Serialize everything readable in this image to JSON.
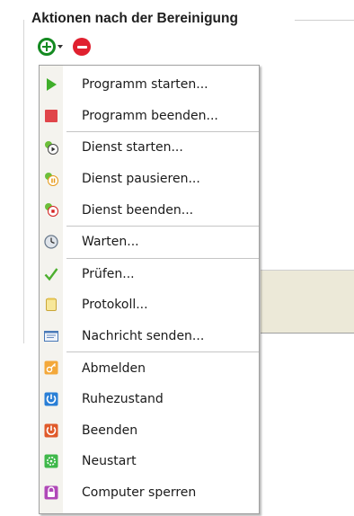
{
  "group": {
    "title": "Aktionen nach der Bereinigung"
  },
  "toolbar": {
    "add_icon": "add-icon",
    "remove_icon": "remove-icon"
  },
  "menu": {
    "items": [
      {
        "label": "Programm starten...",
        "icon": "play-icon",
        "color": "#3fae2a"
      },
      {
        "label": "Programm beenden...",
        "icon": "stop-icon",
        "color": "#e0454a"
      },
      {
        "label": "Dienst starten...",
        "icon": "service-start-icon",
        "color": "#2f2f2f"
      },
      {
        "label": "Dienst pausieren...",
        "icon": "service-pause-icon",
        "color": "#e69a1a"
      },
      {
        "label": "Dienst beenden...",
        "icon": "service-stop-icon",
        "color": "#d42020"
      },
      {
        "label": "Warten...",
        "icon": "clock-icon",
        "color": "#6a7a8c"
      },
      {
        "label": "Prüfen...",
        "icon": "checkmark-icon",
        "color": "#4caf2e"
      },
      {
        "label": "Protokoll...",
        "icon": "log-icon",
        "color": "#f0d060"
      },
      {
        "label": "Nachricht senden...",
        "icon": "message-icon",
        "color": "#4a7ab8"
      },
      {
        "label": "Abmelden",
        "icon": "logoff-icon",
        "color": "#f0a030"
      },
      {
        "label": "Ruhezustand",
        "icon": "hibernate-icon",
        "color": "#2a7fd6"
      },
      {
        "label": "Beenden",
        "icon": "shutdown-icon",
        "color": "#e05a2a"
      },
      {
        "label": "Neustart",
        "icon": "restart-icon",
        "color": "#3fb84a"
      },
      {
        "label": "Computer sperren",
        "icon": "lock-icon",
        "color": "#b048b8"
      }
    ]
  }
}
